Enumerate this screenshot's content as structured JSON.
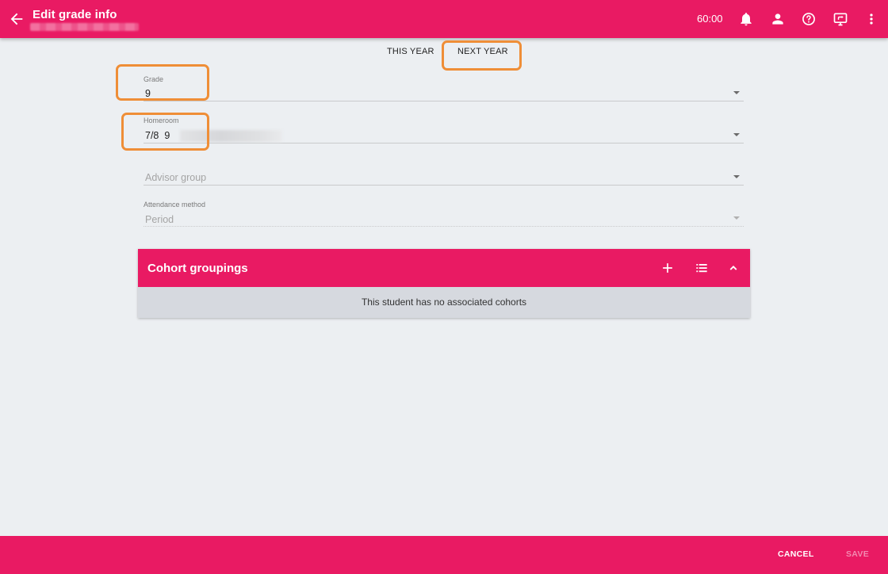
{
  "header": {
    "title": "Edit grade info",
    "timer": "60:00",
    "icons": [
      "arrow-back-icon",
      "bell-icon",
      "person-icon",
      "help-circle-icon",
      "monitor-icon",
      "more-vert-icon"
    ]
  },
  "tabs": [
    {
      "label": "THIS YEAR",
      "selected": false
    },
    {
      "label": "NEXT YEAR",
      "selected": true
    }
  ],
  "form": {
    "grade": {
      "label": "Grade",
      "value": "9"
    },
    "homeroom": {
      "label": "Homeroom",
      "value": "7/8  9"
    },
    "advisor_group": {
      "placeholder": "Advisor group"
    },
    "attendance_method": {
      "label": "Attendance method",
      "value": "Period"
    }
  },
  "cohort": {
    "title": "Cohort groupings",
    "empty_message": "This student has no associated cohorts",
    "icons": [
      "plus-icon",
      "list-icon",
      "chevron-up-icon"
    ]
  },
  "footer": {
    "cancel_label": "CANCEL",
    "save_label": "SAVE"
  },
  "colors": {
    "primary": "#e91a63",
    "highlight": "#ef8e37",
    "background": "#eceff2",
    "panel_body": "#d6d9df"
  }
}
